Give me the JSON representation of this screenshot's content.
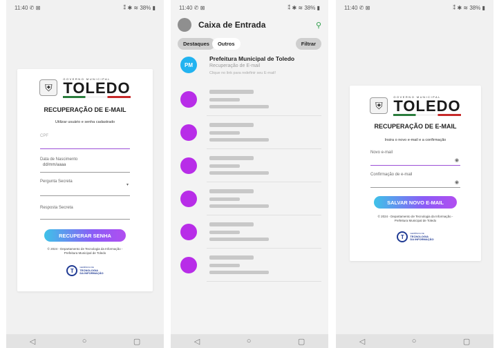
{
  "status": {
    "time": "11:40",
    "indicators": "✆ ⊠",
    "right": "⁑ ✱ ≋ 38% ▮"
  },
  "nav": {
    "back": "◁",
    "home": "○",
    "recent": "▢"
  },
  "screen1": {
    "logo_top": "GOVERNO MUNICIPAL",
    "logo_main": "TOLEDO",
    "title": "RECUPERAÇÃO DE E-MAIL",
    "subtitle": "Utilizar usuário e senha cadastrado",
    "cpf_placeholder": "CPF",
    "birth_label": "Data de Nascimento",
    "birth_value": "dd/mm/aaaa",
    "question_label": "Pergunta Secreta",
    "answer_label": "Resposta Secreta",
    "button": "RECUPERAR SENHA",
    "footer": "© 2024 - Departamento de Tecnologia da Informação - Prefeitura Municipal de Toledo",
    "dept_small": "GERÊNCIA DE",
    "dept_line1": "TECNOLOGIA",
    "dept_line2": "DA INFORMAÇÃO"
  },
  "screen2": {
    "title": "Caixa de Entrada",
    "tabs": [
      "Destaques",
      "Outros"
    ],
    "filter": "Filtrar",
    "first_mail": {
      "avatar": "PM",
      "sender": "Prefeitura Municipal de Toledo",
      "subject": "Recuperação de E-mail",
      "preview": "Clique no link para redefinir seu E-mail!"
    },
    "placeholder_rows": 6
  },
  "screen3": {
    "logo_top": "GOVERNO MUNICIPAL",
    "logo_main": "TOLEDO",
    "title": "RECUPERAÇÃO DE E-MAIL",
    "subtitle": "Insira o novo e-mail e a confirmação",
    "new_email_label": "Novo e-mail",
    "confirm_label": "Confirmação de e-mail",
    "button": "SALVAR NOVO E-MAIL",
    "footer": "© 2024 - Departamento de Tecnologia da Informação - Prefeitura Municipal de Toledo",
    "dept_small": "GERÊNCIA DE",
    "dept_line1": "TECNOLOGIA",
    "dept_line2": "DA INFORMAÇÃO"
  },
  "colors": {
    "accent_start": "#3ec2e8",
    "accent_end": "#b14ef0",
    "avatar_purple": "#b82de8",
    "avatar_blue": "#22b3f0",
    "search_green": "#2e9d4a"
  }
}
